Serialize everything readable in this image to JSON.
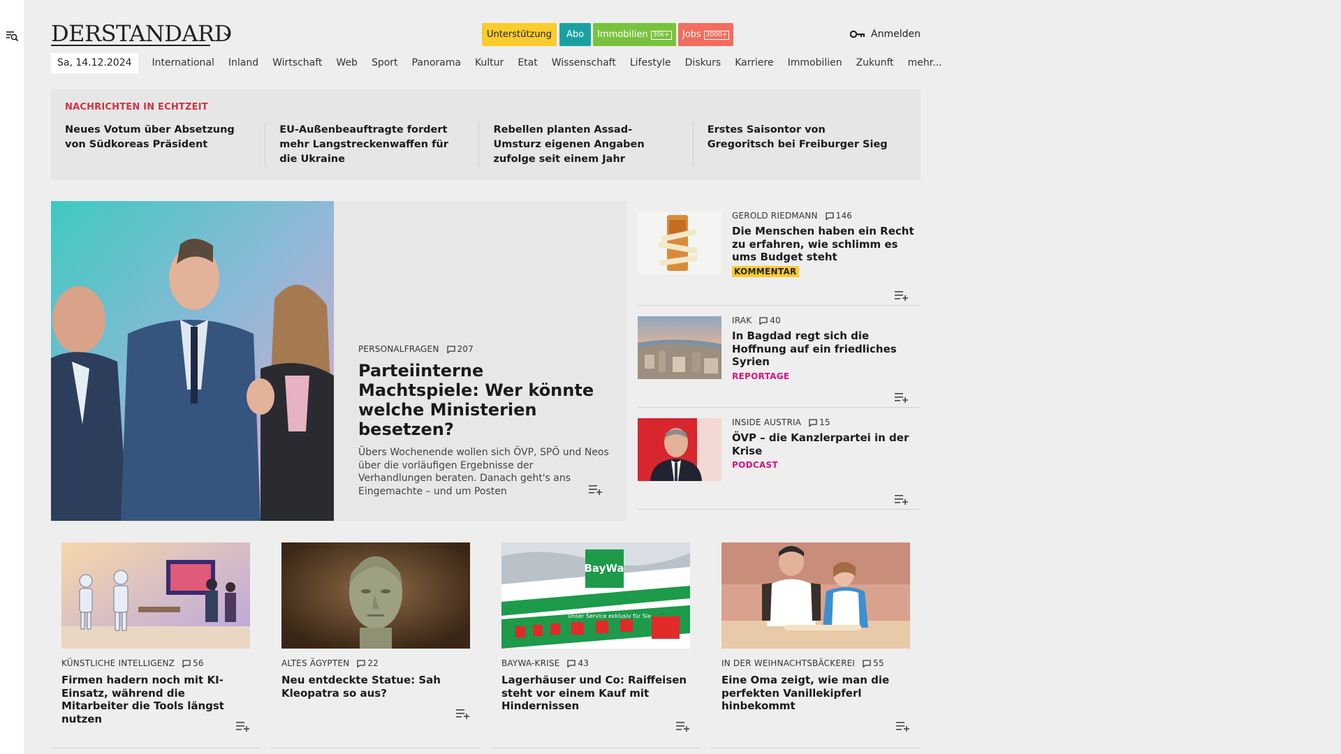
{
  "header": {
    "logo": "DERSTANDARD",
    "support": "Unterstützung",
    "abo": "Abo",
    "immobilien": "Immobilien",
    "immobilien_badge": "30k+",
    "jobs": "Jobs",
    "jobs_badge": "3000+",
    "login": "Anmelden"
  },
  "nav": {
    "date": "Sa, 14.12.2024",
    "items": [
      "International",
      "Inland",
      "Wirtschaft",
      "Web",
      "Sport",
      "Panorama",
      "Kultur",
      "Etat",
      "Wissenschaft",
      "Lifestyle",
      "Diskurs",
      "Karriere",
      "Immobilien",
      "Zukunft",
      "mehr..."
    ]
  },
  "live": {
    "title": "NACHRICHTEN IN ECHTZEIT",
    "items": [
      "Neues Votum über Absetzung von Südkoreas Präsident",
      "EU-Außenbeauftragte fordert mehr Langstreckenwaffen für die Ukraine",
      "Rebellen planten Assad-Umsturz ei­genen Angaben zufolge seit einem Jahr",
      "Erstes Saisontor von Gregoritsch bei Freiburger Sieg"
    ]
  },
  "hero": {
    "kicker": "PERSONALFRAGEN",
    "comments": "207",
    "title": "Parteiinterne Machtspiele: Wer könnte welche Ministerien besetzen?",
    "teaser": "Übers Wochenende wollen sich ÖVP, SPÖ und Neos über die vorläufigen Ergebnisse der Verhandlungen beraten. Danach geht's ans Eingemachte – und um Posten"
  },
  "side": [
    {
      "kicker": "GEROLD RIEDMANN",
      "comments": "146",
      "title": "Die Menschen haben ein Recht zu erfahren, wie schlimm es ums Budget steht",
      "tag": "KOMMENTAR"
    },
    {
      "kicker": "IRAK",
      "comments": "40",
      "title": "In Bagdad regt sich die Hoffnung auf ein friedliches Syrien",
      "tag": "REPORTAGE"
    },
    {
      "kicker": "INSIDE AUSTRIA",
      "comments": "15",
      "title": "ÖVP – die Kanzlerpartei in der Krise",
      "tag": "PODCAST"
    }
  ],
  "cards": [
    {
      "kicker": "KÜNSTLICHE INTELLIGENZ",
      "comments": "56",
      "title": "Firmen hadern noch mit KI-Einsatz, während die Mitarbeiter die Tools längst nutzen"
    },
    {
      "kicker": "ALTES ÄGYPTEN",
      "comments": "22",
      "title": "Neu entdeckte Statue: Sah Kleopatra so aus?"
    },
    {
      "kicker": "BAYWA-KRISE",
      "comments": "43",
      "title": "Lagerhäuser und Co: Raiffeisen steht vor einem Kauf mit Hindernissen"
    },
    {
      "kicker": "IN DER WEIHNACHTSBÄCKEREI",
      "comments": "55",
      "title": "Eine Oma zeigt, wie man die perfekten Vanillekipferl hinbekommt"
    }
  ],
  "images": {
    "baywa_sign": "BayWa",
    "baywa_banner": "Unser Service exklusiv für Sie"
  }
}
